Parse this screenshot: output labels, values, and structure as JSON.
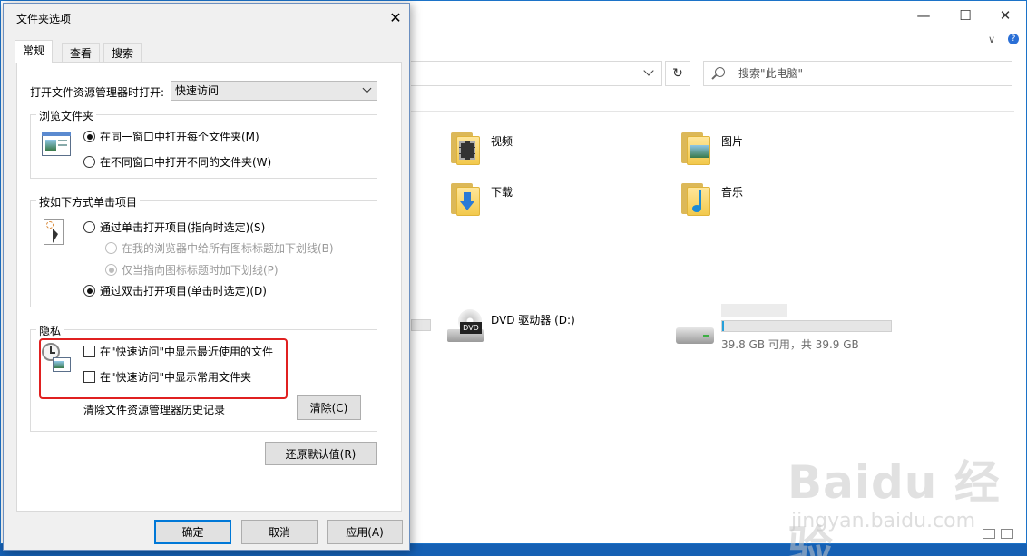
{
  "explorer": {
    "search_placeholder": "搜索\"此电脑\"",
    "folders": [
      {
        "label": "视频",
        "icon": "video-folder-icon"
      },
      {
        "label": "图片",
        "icon": "pictures-folder-icon"
      },
      {
        "label": "下载",
        "icon": "downloads-folder-icon"
      },
      {
        "label": "音乐",
        "icon": "music-folder-icon"
      }
    ],
    "drives": [
      {
        "label": "DVD 驱动器 (D:)",
        "icon": "dvd-drive-icon"
      },
      {
        "label": "",
        "space": "39.8 GB 可用，共 39.9 GB",
        "icon": "hard-drive-icon",
        "used_fraction": 0.003
      }
    ]
  },
  "dialog": {
    "title": "文件夹选项",
    "tabs": [
      {
        "label": "常规",
        "active": true
      },
      {
        "label": "查看",
        "active": false
      },
      {
        "label": "搜索",
        "active": false
      }
    ],
    "open_explorer_label": "打开文件资源管理器时打开:",
    "open_explorer_value": "快速访问",
    "browse_group": {
      "title": "浏览文件夹",
      "options": [
        {
          "label": "在同一窗口中打开每个文件夹(M)",
          "checked": true
        },
        {
          "label": "在不同窗口中打开不同的文件夹(W)",
          "checked": false
        }
      ]
    },
    "click_group": {
      "title": "按如下方式单击项目",
      "options": [
        {
          "label": "通过单击打开项目(指向时选定)(S)",
          "checked": false,
          "disabled": false
        },
        {
          "label": "在我的浏览器中给所有图标标题加下划线(B)",
          "checked": false,
          "disabled": true
        },
        {
          "label": "仅当指向图标标题时加下划线(P)",
          "checked": true,
          "disabled": true
        },
        {
          "label": "通过双击打开项目(单击时选定)(D)",
          "checked": true,
          "disabled": false
        }
      ]
    },
    "privacy_group": {
      "title": "隐私",
      "checkboxes": [
        {
          "label": "在\"快速访问\"中显示最近使用的文件",
          "checked": false
        },
        {
          "label": "在\"快速访问\"中显示常用文件夹",
          "checked": false
        }
      ],
      "clear_history_label": "清除文件资源管理器历史记录",
      "clear_button": "清除(C)"
    },
    "restore_defaults_button": "还原默认值(R)",
    "ok_button": "确定",
    "cancel_button": "取消",
    "apply_button": "应用(A)"
  },
  "watermark": {
    "main": "Baidu 经验",
    "sub": "jingyan.baidu.com"
  },
  "colors": {
    "highlight": "#e02020",
    "accent": "#0078d7",
    "desktop": "#1560b4"
  }
}
